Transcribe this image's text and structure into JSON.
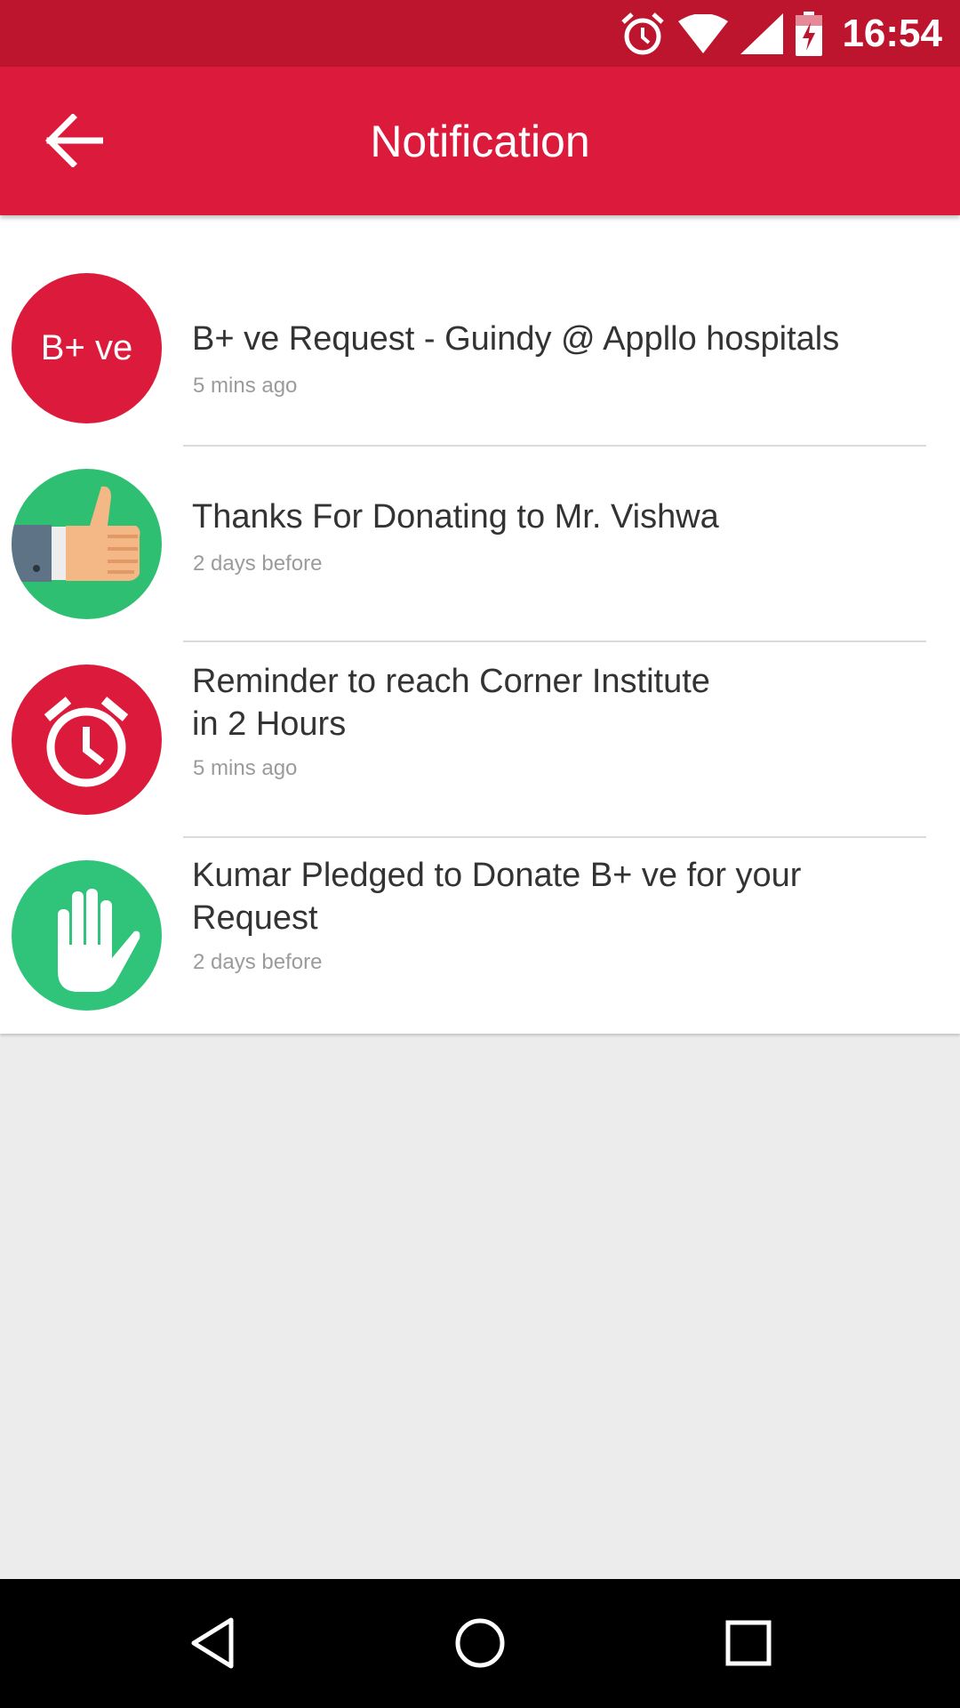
{
  "status_bar": {
    "time": "16:54",
    "icons": [
      "alarm-icon",
      "wifi-icon",
      "signal-icon",
      "battery-charging-icon"
    ]
  },
  "header": {
    "title": "Notification",
    "back_icon": "arrow-back-icon",
    "color": "#dc1a3b"
  },
  "notifications": [
    {
      "avatar_type": "text",
      "avatar_text": "B+ ve",
      "avatar_color": "#dc1a3b",
      "title_lines": [
        "B+ ve Request - Guindy @ Appllo hospitals"
      ],
      "time": "5 mins ago"
    },
    {
      "avatar_type": "thumbs-up-icon",
      "avatar_color": "#2fbf72",
      "title_lines": [
        "Thanks For Donating to Mr. Vishwa"
      ],
      "time": "2 days before"
    },
    {
      "avatar_type": "alarm-clock-icon",
      "avatar_color": "#dc1a3b",
      "title_lines": [
        "Reminder to reach Corner Institute",
        "in 2 Hours"
      ],
      "time": "5 mins ago"
    },
    {
      "avatar_type": "raised-hand-icon",
      "avatar_color": "#2fc47a",
      "title_lines": [
        "Kumar Pledged to Donate B+ ve for your",
        "Request"
      ],
      "time": "2 days before"
    }
  ],
  "nav_bar": {
    "buttons": [
      "back-triangle-icon",
      "home-circle-icon",
      "recents-square-icon"
    ]
  }
}
